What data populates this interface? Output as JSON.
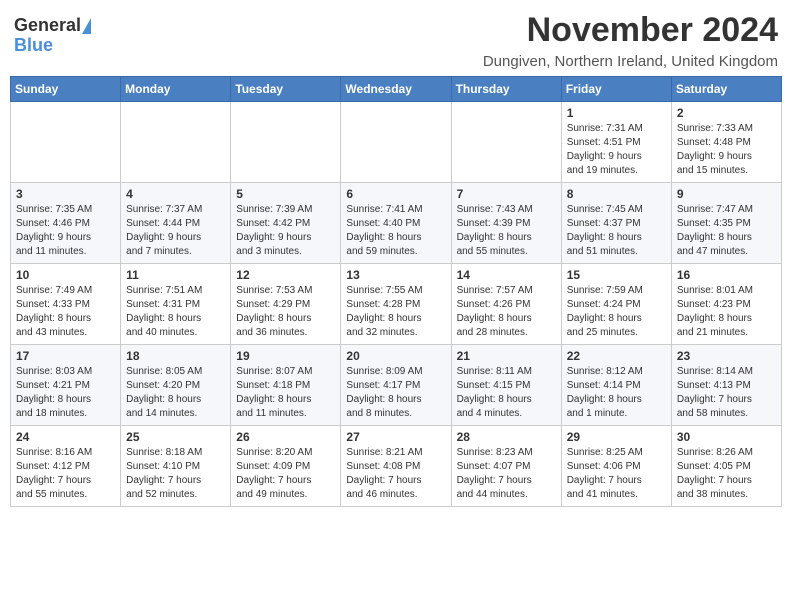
{
  "header": {
    "logo_general": "General",
    "logo_blue": "Blue",
    "main_title": "November 2024",
    "subtitle": "Dungiven, Northern Ireland, United Kingdom"
  },
  "calendar": {
    "days_of_week": [
      "Sunday",
      "Monday",
      "Tuesday",
      "Wednesday",
      "Thursday",
      "Friday",
      "Saturday"
    ],
    "weeks": [
      [
        {
          "day": "",
          "info": ""
        },
        {
          "day": "",
          "info": ""
        },
        {
          "day": "",
          "info": ""
        },
        {
          "day": "",
          "info": ""
        },
        {
          "day": "",
          "info": ""
        },
        {
          "day": "1",
          "info": "Sunrise: 7:31 AM\nSunset: 4:51 PM\nDaylight: 9 hours\nand 19 minutes."
        },
        {
          "day": "2",
          "info": "Sunrise: 7:33 AM\nSunset: 4:48 PM\nDaylight: 9 hours\nand 15 minutes."
        }
      ],
      [
        {
          "day": "3",
          "info": "Sunrise: 7:35 AM\nSunset: 4:46 PM\nDaylight: 9 hours\nand 11 minutes."
        },
        {
          "day": "4",
          "info": "Sunrise: 7:37 AM\nSunset: 4:44 PM\nDaylight: 9 hours\nand 7 minutes."
        },
        {
          "day": "5",
          "info": "Sunrise: 7:39 AM\nSunset: 4:42 PM\nDaylight: 9 hours\nand 3 minutes."
        },
        {
          "day": "6",
          "info": "Sunrise: 7:41 AM\nSunset: 4:40 PM\nDaylight: 8 hours\nand 59 minutes."
        },
        {
          "day": "7",
          "info": "Sunrise: 7:43 AM\nSunset: 4:39 PM\nDaylight: 8 hours\nand 55 minutes."
        },
        {
          "day": "8",
          "info": "Sunrise: 7:45 AM\nSunset: 4:37 PM\nDaylight: 8 hours\nand 51 minutes."
        },
        {
          "day": "9",
          "info": "Sunrise: 7:47 AM\nSunset: 4:35 PM\nDaylight: 8 hours\nand 47 minutes."
        }
      ],
      [
        {
          "day": "10",
          "info": "Sunrise: 7:49 AM\nSunset: 4:33 PM\nDaylight: 8 hours\nand 43 minutes."
        },
        {
          "day": "11",
          "info": "Sunrise: 7:51 AM\nSunset: 4:31 PM\nDaylight: 8 hours\nand 40 minutes."
        },
        {
          "day": "12",
          "info": "Sunrise: 7:53 AM\nSunset: 4:29 PM\nDaylight: 8 hours\nand 36 minutes."
        },
        {
          "day": "13",
          "info": "Sunrise: 7:55 AM\nSunset: 4:28 PM\nDaylight: 8 hours\nand 32 minutes."
        },
        {
          "day": "14",
          "info": "Sunrise: 7:57 AM\nSunset: 4:26 PM\nDaylight: 8 hours\nand 28 minutes."
        },
        {
          "day": "15",
          "info": "Sunrise: 7:59 AM\nSunset: 4:24 PM\nDaylight: 8 hours\nand 25 minutes."
        },
        {
          "day": "16",
          "info": "Sunrise: 8:01 AM\nSunset: 4:23 PM\nDaylight: 8 hours\nand 21 minutes."
        }
      ],
      [
        {
          "day": "17",
          "info": "Sunrise: 8:03 AM\nSunset: 4:21 PM\nDaylight: 8 hours\nand 18 minutes."
        },
        {
          "day": "18",
          "info": "Sunrise: 8:05 AM\nSunset: 4:20 PM\nDaylight: 8 hours\nand 14 minutes."
        },
        {
          "day": "19",
          "info": "Sunrise: 8:07 AM\nSunset: 4:18 PM\nDaylight: 8 hours\nand 11 minutes."
        },
        {
          "day": "20",
          "info": "Sunrise: 8:09 AM\nSunset: 4:17 PM\nDaylight: 8 hours\nand 8 minutes."
        },
        {
          "day": "21",
          "info": "Sunrise: 8:11 AM\nSunset: 4:15 PM\nDaylight: 8 hours\nand 4 minutes."
        },
        {
          "day": "22",
          "info": "Sunrise: 8:12 AM\nSunset: 4:14 PM\nDaylight: 8 hours\nand 1 minute."
        },
        {
          "day": "23",
          "info": "Sunrise: 8:14 AM\nSunset: 4:13 PM\nDaylight: 7 hours\nand 58 minutes."
        }
      ],
      [
        {
          "day": "24",
          "info": "Sunrise: 8:16 AM\nSunset: 4:12 PM\nDaylight: 7 hours\nand 55 minutes."
        },
        {
          "day": "25",
          "info": "Sunrise: 8:18 AM\nSunset: 4:10 PM\nDaylight: 7 hours\nand 52 minutes."
        },
        {
          "day": "26",
          "info": "Sunrise: 8:20 AM\nSunset: 4:09 PM\nDaylight: 7 hours\nand 49 minutes."
        },
        {
          "day": "27",
          "info": "Sunrise: 8:21 AM\nSunset: 4:08 PM\nDaylight: 7 hours\nand 46 minutes."
        },
        {
          "day": "28",
          "info": "Sunrise: 8:23 AM\nSunset: 4:07 PM\nDaylight: 7 hours\nand 44 minutes."
        },
        {
          "day": "29",
          "info": "Sunrise: 8:25 AM\nSunset: 4:06 PM\nDaylight: 7 hours\nand 41 minutes."
        },
        {
          "day": "30",
          "info": "Sunrise: 8:26 AM\nSunset: 4:05 PM\nDaylight: 7 hours\nand 38 minutes."
        }
      ]
    ]
  }
}
